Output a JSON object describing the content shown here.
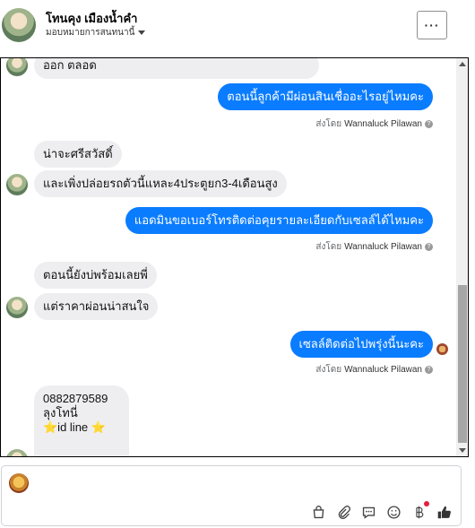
{
  "header": {
    "name": "โทนคุง เมืองน้ำคำ",
    "subtitle": "มอบหมายการสนทนานี้",
    "more_label": "···"
  },
  "messages": [
    {
      "side": "in",
      "text": "ออก ตลอด"
    },
    {
      "side": "out",
      "text": "ตอนนี้ลูกค้ามีผ่อนสินเชื่ออะไรอยู่ไหมคะ",
      "sent_label": "ส่งโดย",
      "sender": "Wannaluck Pilawan"
    },
    {
      "side": "in",
      "text": "น่าจะศรีสวัสดิ์"
    },
    {
      "side": "in",
      "text": "และเพิ่งปล่อยรถตัวนี้แหละ4ประตูยก3-4เดือนสูง"
    },
    {
      "side": "out",
      "text": "แอดมินขอเบอร์โทรติดต่อคุยรายละเอียดกับเซลล์ได้ไหมคะ",
      "sent_label": "ส่งโดย",
      "sender": "Wannaluck Pilawan"
    },
    {
      "side": "in",
      "text": "ตอนนี้ยังบ่พร้อมเลยพี่"
    },
    {
      "side": "in",
      "text": "แต่ราคาผ่อนน่าสนใจ"
    },
    {
      "side": "out",
      "text": "เซลล์ติดต่อไปพรุ่งนี้นะคะ",
      "sent_label": "ส่งโดย",
      "sender": "Wannaluck Pilawan"
    },
    {
      "side": "in",
      "lines": [
        "0882879589",
        "ลุงโทนี่",
        "⭐id line ⭐"
      ]
    }
  ],
  "composer": {
    "icons": [
      "bag-icon",
      "paperclip-icon",
      "chat-template-icon",
      "emoji-icon",
      "baht-icon",
      "thumbs-up-icon"
    ]
  }
}
